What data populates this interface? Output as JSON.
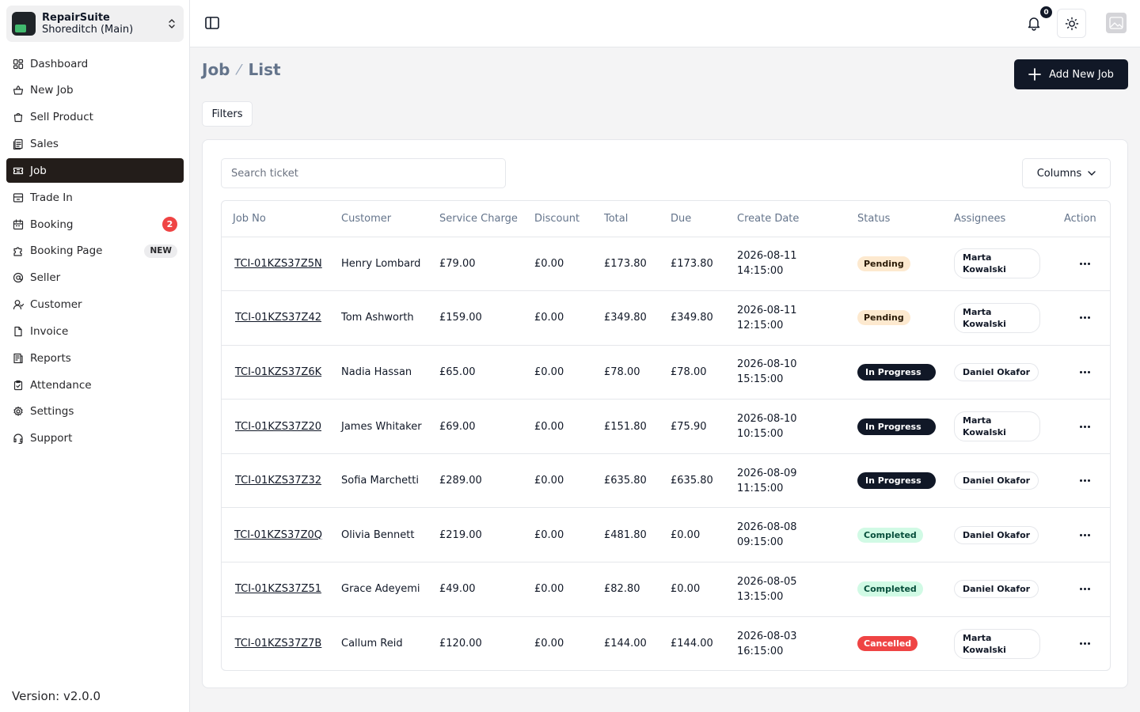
{
  "store": {
    "name": "RepairSuite",
    "branch": "Shoreditch (Main)"
  },
  "nav": [
    {
      "label": "Dashboard",
      "icon": "dashboard-icon"
    },
    {
      "label": "New Job",
      "icon": "basket-icon"
    },
    {
      "label": "Sell Product",
      "icon": "shopping-bag-icon"
    },
    {
      "label": "Sales",
      "icon": "receipt-stack-icon"
    },
    {
      "label": "Job",
      "icon": "ticket-icon",
      "active": true
    },
    {
      "label": "Trade In",
      "icon": "archive-icon"
    },
    {
      "label": "Booking",
      "icon": "calendar-icon",
      "badge": "2"
    },
    {
      "label": "Booking Page",
      "icon": "puzzle-icon",
      "tag": "NEW"
    },
    {
      "label": "Seller",
      "icon": "at-sign-icon"
    },
    {
      "label": "Customer",
      "icon": "user-icon"
    },
    {
      "label": "Invoice",
      "icon": "file-icon"
    },
    {
      "label": "Reports",
      "icon": "report-icon"
    },
    {
      "label": "Attendance",
      "icon": "clipboard-check-icon"
    },
    {
      "label": "Settings",
      "icon": "gear-icon"
    },
    {
      "label": "Support",
      "icon": "headset-icon"
    }
  ],
  "version": "Version: v2.0.0",
  "topbar": {
    "notification_count": "0"
  },
  "breadcrumb": {
    "section": "Job",
    "page": "List"
  },
  "actions": {
    "add_label": "Add New Job",
    "filters_label": "Filters",
    "columns_label": "Columns"
  },
  "search": {
    "placeholder": "Search ticket"
  },
  "table": {
    "headers": [
      "Job No",
      "Customer",
      "Service Charge",
      "Discount",
      "Total",
      "Due",
      "Create Date",
      "Status",
      "Assignees",
      "Action"
    ],
    "rows": [
      {
        "job_no": "TCI-01KZS37Z5N",
        "customer": "Henry Lombard",
        "service_charge": "£79.00",
        "discount": "£0.00",
        "total": "£173.80",
        "due": "£173.80",
        "create_date": "2026-08-11 14:15:00",
        "status": "Pending",
        "assignee": "Marta Kowalski"
      },
      {
        "job_no": "TCI-01KZS37Z42",
        "customer": "Tom Ashworth",
        "service_charge": "£159.00",
        "discount": "£0.00",
        "total": "£349.80",
        "due": "£349.80",
        "create_date": "2026-08-11 12:15:00",
        "status": "Pending",
        "assignee": "Marta Kowalski"
      },
      {
        "job_no": "TCI-01KZS37Z6K",
        "customer": "Nadia Hassan",
        "service_charge": "£65.00",
        "discount": "£0.00",
        "total": "£78.00",
        "due": "£78.00",
        "create_date": "2026-08-10 15:15:00",
        "status": "In Progress",
        "assignee": "Daniel Okafor"
      },
      {
        "job_no": "TCI-01KZS37Z20",
        "customer": "James Whitaker",
        "service_charge": "£69.00",
        "discount": "£0.00",
        "total": "£151.80",
        "due": "£75.90",
        "create_date": "2026-08-10 10:15:00",
        "status": "In Progress",
        "assignee": "Marta Kowalski"
      },
      {
        "job_no": "TCI-01KZS37Z32",
        "customer": "Sofia Marchetti",
        "service_charge": "£289.00",
        "discount": "£0.00",
        "total": "£635.80",
        "due": "£635.80",
        "create_date": "2026-08-09 11:15:00",
        "status": "In Progress",
        "assignee": "Daniel Okafor"
      },
      {
        "job_no": "TCI-01KZS37Z0Q",
        "customer": "Olivia Bennett",
        "service_charge": "£219.00",
        "discount": "£0.00",
        "total": "£481.80",
        "due": "£0.00",
        "create_date": "2026-08-08 09:15:00",
        "status": "Completed",
        "assignee": "Daniel Okafor"
      },
      {
        "job_no": "TCI-01KZS37Z51",
        "customer": "Grace Adeyemi",
        "service_charge": "£49.00",
        "discount": "£0.00",
        "total": "£82.80",
        "due": "£0.00",
        "create_date": "2026-08-05 13:15:00",
        "status": "Completed",
        "assignee": "Daniel Okafor"
      },
      {
        "job_no": "TCI-01KZS37Z7B",
        "customer": "Callum Reid",
        "service_charge": "£120.00",
        "discount": "£0.00",
        "total": "£144.00",
        "due": "£144.00",
        "create_date": "2026-08-03 16:15:00",
        "status": "Cancelled",
        "assignee": "Marta Kowalski"
      }
    ]
  },
  "colors": {
    "accent": "#111827",
    "active_nav": "#231d1a",
    "badge": "#ef4444",
    "pending": "#fde9cf",
    "completed": "#d1fae5",
    "cancelled": "#ef4444"
  }
}
